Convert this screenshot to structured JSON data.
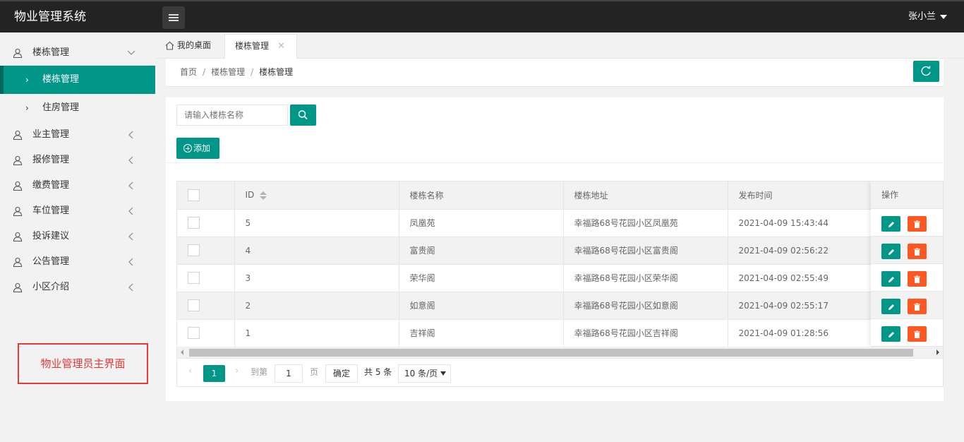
{
  "header": {
    "app_title": "物业管理系统",
    "user_name": "张小兰"
  },
  "sidebar": {
    "items": [
      {
        "label": "楼栋管理",
        "expanded": true,
        "children": [
          {
            "label": "楼栋管理",
            "active": true
          },
          {
            "label": "住房管理",
            "active": false
          }
        ]
      },
      {
        "label": "业主管理"
      },
      {
        "label": "报修管理"
      },
      {
        "label": "缴费管理"
      },
      {
        "label": "车位管理"
      },
      {
        "label": "投诉建议"
      },
      {
        "label": "公告管理"
      },
      {
        "label": "小区介绍"
      }
    ],
    "note": "物业管理员主界面"
  },
  "tabs": {
    "home": "我的桌面",
    "active": "楼栋管理"
  },
  "breadcrumb": {
    "home": "首页",
    "parent": "楼栋管理",
    "current": "楼栋管理"
  },
  "search": {
    "placeholder": "请输入楼栋名称",
    "value": ""
  },
  "toolbar": {
    "add_label": "添加"
  },
  "table": {
    "columns": [
      "ID",
      "楼栋名称",
      "楼栋地址",
      "发布时间",
      "操作"
    ],
    "rows": [
      {
        "id": "5",
        "name": "凤凰苑",
        "address": "幸福路68号花园小区凤凰苑",
        "time": "2021-04-09 15:43:44"
      },
      {
        "id": "4",
        "name": "富贵阁",
        "address": "幸福路68号花园小区富贵阁",
        "time": "2021-04-09 02:56:22"
      },
      {
        "id": "3",
        "name": "荣华阁",
        "address": "幸福路68号花园小区荣华阁",
        "time": "2021-04-09 02:55:49"
      },
      {
        "id": "2",
        "name": "如意阁",
        "address": "幸福路68号花园小区如意阁",
        "time": "2021-04-09 02:55:17"
      },
      {
        "id": "1",
        "name": "吉祥阁",
        "address": "幸福路68号花园小区吉祥阁",
        "time": "2021-04-09 01:28:56"
      }
    ]
  },
  "pager": {
    "current_page": "1",
    "goto_label": "到第",
    "goto_value": "1",
    "page_label": "页",
    "confirm_label": "确定",
    "total_label": "共 5 条",
    "page_size": "10 条/页"
  },
  "colors": {
    "primary": "#009688",
    "danger": "#ff5722",
    "header_bg": "#232323",
    "note_red": "#e53935"
  }
}
